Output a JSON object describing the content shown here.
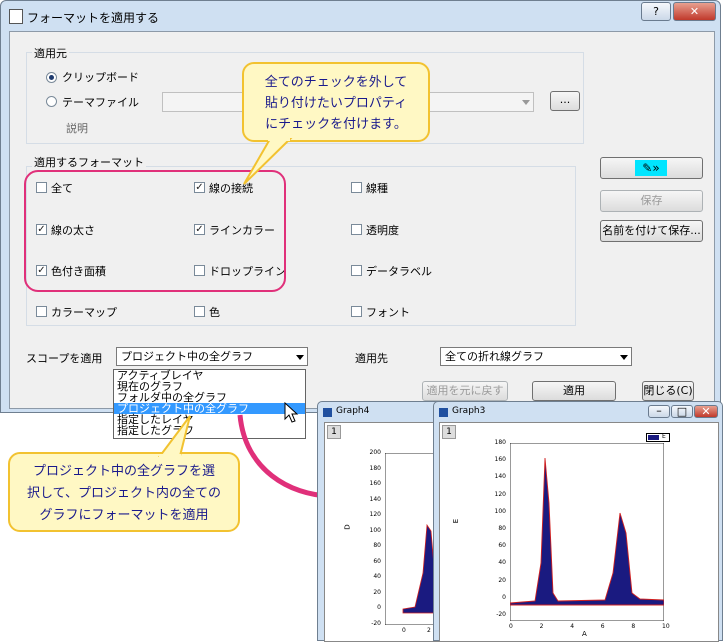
{
  "dialog": {
    "title": "フォーマットを適用する",
    "help_label": "?",
    "close_label": "✕"
  },
  "source": {
    "legend": "適用元",
    "clipboard_label": "クリップボード",
    "theme_label": "テーマファイル",
    "browse_label": "...",
    "description_label": "説明"
  },
  "format": {
    "legend": "適用するフォーマット",
    "items": [
      {
        "label": "全て",
        "checked": false
      },
      {
        "label": "線の接続",
        "checked": true
      },
      {
        "label": "線種",
        "checked": false
      },
      {
        "label": "線の太さ",
        "checked": true
      },
      {
        "label": "ラインカラー",
        "checked": true
      },
      {
        "label": "透明度",
        "checked": false
      },
      {
        "label": "色付き面積",
        "checked": true
      },
      {
        "label": "ドロップライン",
        "checked": false
      },
      {
        "label": "データラベル",
        "checked": false
      },
      {
        "label": "カラーマップ",
        "checked": false
      },
      {
        "label": "色",
        "checked": false
      },
      {
        "label": "フォント",
        "checked": false
      }
    ]
  },
  "side_buttons": {
    "save_label": "保存",
    "save_as_label": "名前を付けて保存..."
  },
  "scope": {
    "label": "スコープを適用",
    "selected": "プロジェクト中の全グラフ",
    "options": [
      "アクティブレイヤ",
      "現在のグラフ",
      "フォルダ中の全グラフ",
      "プロジェクト中の全グラフ",
      "指定したレイヤ",
      "指定したグラフ"
    ]
  },
  "target": {
    "label": "適用先",
    "selected": "全ての折れ線グラフ"
  },
  "bottom_buttons": {
    "undo_label": "適用を元に戻す",
    "apply_label": "適用",
    "close_label": "閉じる(C)"
  },
  "callouts": {
    "top_line1": "全てのチェックを外して",
    "top_line2": "貼り付けたいプロパティ",
    "top_line3": "にチェックを付けます。",
    "bottom_line1": "プロジェクト中の全グラフを選",
    "bottom_line2": "択して、プロジェクト内の全ての",
    "bottom_line3": "グラフにフォーマットを適用"
  },
  "graph4": {
    "title": "Graph4",
    "layer": "1",
    "ylabel": "D",
    "yticks": [
      "200",
      "180",
      "160",
      "140",
      "120",
      "100",
      "80",
      "60",
      "40",
      "20",
      "0",
      "-20"
    ],
    "xticks": [
      "0",
      "2"
    ]
  },
  "graph3": {
    "title": "Graph3",
    "layer": "1",
    "ylabel": "E",
    "xlabel": "A",
    "legend": "E",
    "yticks": [
      "180",
      "160",
      "140",
      "120",
      "100",
      "80",
      "60",
      "40",
      "20",
      "0",
      "-20"
    ],
    "xticks": [
      "0",
      "2",
      "4",
      "6",
      "8",
      "10"
    ]
  },
  "colors": {
    "accent_highlight": "#3399ff",
    "callout_border": "#f2c230",
    "pink_frame": "#e0307a",
    "plot_fill": "#1a1a80",
    "plot_line": "#d02020"
  }
}
